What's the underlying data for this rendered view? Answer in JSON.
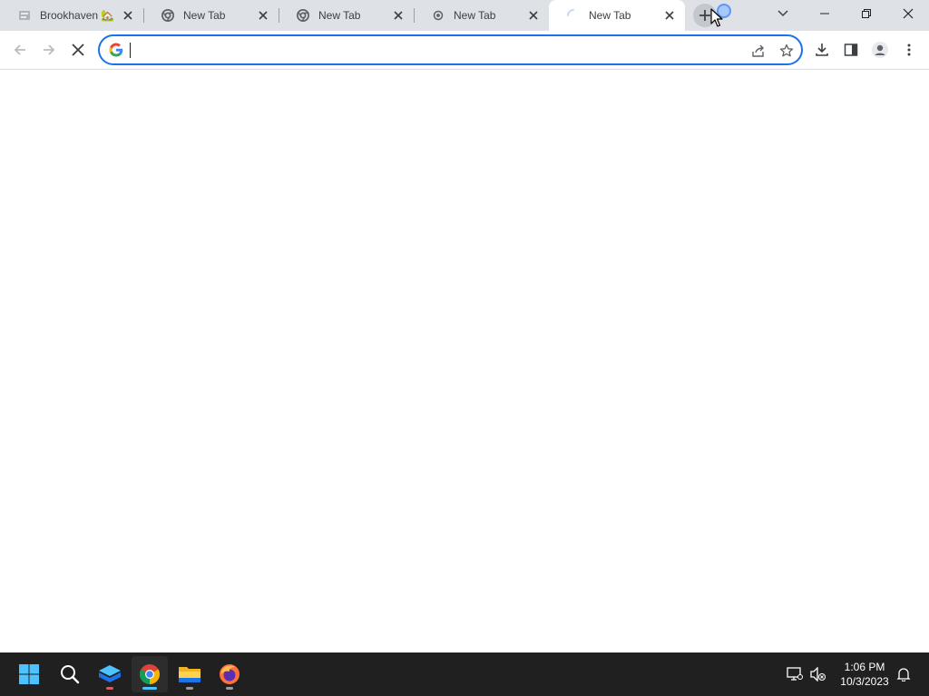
{
  "browser": {
    "tabs": [
      {
        "title": "Brookhaven 🏡",
        "icon": "generic-page-icon",
        "active": false
      },
      {
        "title": "New Tab",
        "icon": "chrome-icon",
        "active": false
      },
      {
        "title": "New Tab",
        "icon": "chrome-icon",
        "active": false
      },
      {
        "title": "New Tab",
        "icon": "chrome-small-icon",
        "active": false
      },
      {
        "title": "New Tab",
        "icon": "loading-spinner-icon",
        "active": true
      }
    ],
    "omnibox": {
      "value": "",
      "placeholder": ""
    },
    "icons": {
      "back": "back-arrow-icon",
      "forward": "forward-arrow-icon",
      "stop": "stop-loading-icon",
      "share": "share-icon",
      "bookmark": "star-icon",
      "download": "download-icon",
      "side_panel": "side-panel-icon",
      "profile": "profile-icon",
      "menu": "more-vert-icon"
    }
  },
  "taskbar": {
    "apps": [
      "windows-start-icon",
      "search-icon",
      "app-icon",
      "chrome-icon",
      "file-explorer-icon",
      "firefox-icon"
    ],
    "clock": {
      "time": "1:06 PM",
      "date": "10/3/2023"
    }
  },
  "colors": {
    "accent": "#1a73e8",
    "tabstrip": "#dee1e6",
    "taskbar": "#202020"
  }
}
